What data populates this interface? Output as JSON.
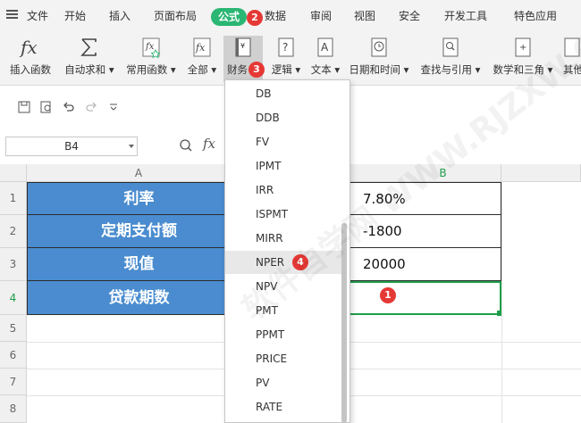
{
  "menubar": {
    "file_label": "文件",
    "tabs": [
      "开始",
      "插入",
      "页面布局",
      "公式",
      "数据",
      "审阅",
      "视图",
      "安全",
      "开发工具",
      "特色应用"
    ],
    "active_tab": "公式"
  },
  "ribbon": {
    "buttons": [
      {
        "label": "插入函数",
        "icon": "fx-icon"
      },
      {
        "label": "自动求和",
        "icon": "sigma-icon"
      },
      {
        "label": "常用函数",
        "icon": "star-function-icon"
      },
      {
        "label": "全部",
        "icon": "fx-all-icon"
      },
      {
        "label": "财务",
        "icon": "finance-book-icon"
      },
      {
        "label": "逻辑",
        "icon": "logic-question-icon"
      },
      {
        "label": "文本",
        "icon": "text-a-icon"
      },
      {
        "label": "日期和时间",
        "icon": "clock-icon"
      },
      {
        "label": "查找与引用",
        "icon": "lookup-magnifier-icon"
      },
      {
        "label": "数学和三角",
        "icon": "math-icon"
      },
      {
        "label": "其他",
        "icon": "other-icon"
      }
    ]
  },
  "formula_bar": {
    "name_box": "B4",
    "fx_label": "fx"
  },
  "sheet": {
    "columns": [
      "A",
      "B"
    ],
    "rows": [
      "1",
      "2",
      "3",
      "4",
      "5",
      "6",
      "7",
      "8"
    ],
    "cells": [
      {
        "a": "利率",
        "b": "7.80%"
      },
      {
        "a": "定期支付额",
        "b": "-1800"
      },
      {
        "a": "现值",
        "b": "20000"
      },
      {
        "a": "贷款期数",
        "b": ""
      }
    ]
  },
  "finance_menu": {
    "items": [
      "DB",
      "DDB",
      "FV",
      "IPMT",
      "IRR",
      "ISPMT",
      "MIRR",
      "NPER",
      "NPV",
      "PMT",
      "PPMT",
      "PRICE",
      "PV",
      "RATE"
    ],
    "highlighted": "NPER"
  },
  "badges": {
    "one": "1",
    "two": "2",
    "three": "3",
    "four": "4"
  },
  "watermark": "软件自学网 WWW.RJZXW.COM",
  "colors": {
    "active_tab": "#2ab673",
    "header_cell": "#4a8ccf",
    "badge": "#e53935",
    "selection": "#1e9e4a"
  }
}
